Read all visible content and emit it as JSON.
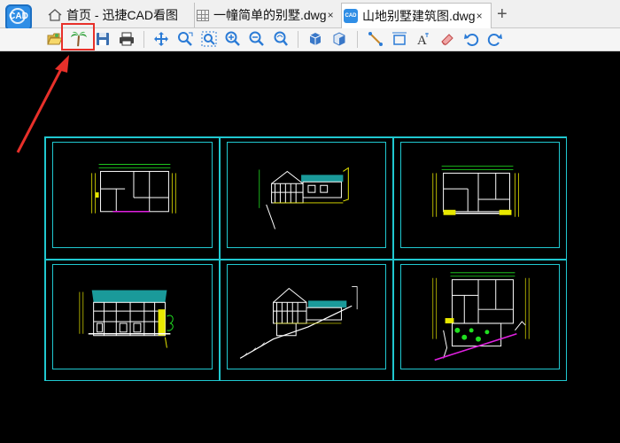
{
  "app": {
    "logo_text": "CAD",
    "brand_color": "#2f8ee6"
  },
  "tabs": [
    {
      "label": "首页 - 迅捷CAD看图",
      "icon": "home-icon",
      "active": false
    },
    {
      "label": "一幢简单的别墅.dwg",
      "icon": "grid-icon",
      "active": false
    },
    {
      "label": "山地别墅建筑图.dwg",
      "icon": "cad-file-icon",
      "active": true
    }
  ],
  "tab_close": "×",
  "new_tab": "+",
  "toolbar": {
    "items": [
      "open-file-icon",
      "palm-tree-icon",
      "save-icon",
      "print-icon",
      "pan-icon",
      "zoom-window-icon",
      "zoom-extents-icon",
      "zoom-in-icon",
      "zoom-out-icon",
      "zoom-previous-icon",
      "3d-view-icon",
      "3d-orbit-icon",
      "measure-distance-icon",
      "measure-area-icon",
      "text-icon",
      "eraser-icon",
      "undo-icon",
      "redo-icon"
    ]
  },
  "colors": {
    "canvas": "#000000",
    "frame": "#20c8d0",
    "highlight": "#e8302a",
    "drawing_white": "#ffffff",
    "drawing_yellow": "#e8e800",
    "drawing_green": "#20e020",
    "drawing_magenta": "#e020e0",
    "roof_teal": "#1a9a9a"
  },
  "sheets": [
    {
      "name": "floor-plan-1"
    },
    {
      "name": "side-elevation-1"
    },
    {
      "name": "floor-plan-2"
    },
    {
      "name": "front-elevation"
    },
    {
      "name": "side-elevation-2"
    },
    {
      "name": "site-plan"
    }
  ]
}
